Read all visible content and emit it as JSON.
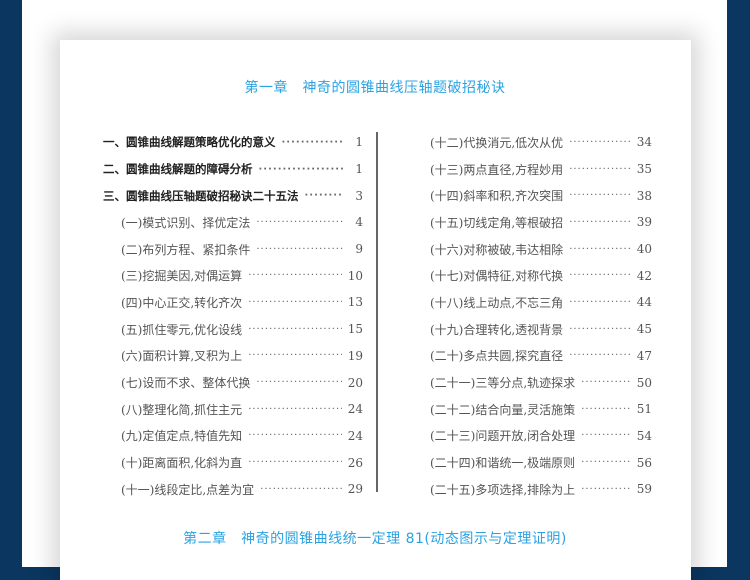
{
  "chapter1_title": "第一章　神奇的圆锥曲线压轴题破招秘诀",
  "chapter2_title": "第二章　神奇的圆锥曲线统一定理 81(动态图示与定理证明)",
  "left_items": [
    {
      "label": "一、圆锥曲线解题策略优化的意义",
      "page": "1"
    },
    {
      "label": "二、圆锥曲线解题的障碍分析",
      "page": "1"
    },
    {
      "label": "三、圆锥曲线压轴题破招秘诀二十五法",
      "page": "3"
    },
    {
      "label": "(一)模式识别、择优定法",
      "page": "4"
    },
    {
      "label": "(二)布列方程、紧扣条件",
      "page": "9"
    },
    {
      "label": "(三)挖掘美因,对偶运算",
      "page": "10"
    },
    {
      "label": "(四)中心正交,转化齐次",
      "page": "13"
    },
    {
      "label": "(五)抓住零元,优化设线",
      "page": "15"
    },
    {
      "label": "(六)面积计算,叉积为上",
      "page": "19"
    },
    {
      "label": "(七)设而不求、整体代换",
      "page": "20"
    },
    {
      "label": "(八)整理化简,抓住主元",
      "page": "24"
    },
    {
      "label": "(九)定值定点,特值先知",
      "page": "24"
    },
    {
      "label": "(十)距离面积,化斜为直",
      "page": "26"
    },
    {
      "label": "(十一)线段定比,点差为宜",
      "page": "29"
    }
  ],
  "right_items": [
    {
      "label": "(十二)代换消元,低次从优",
      "page": "34"
    },
    {
      "label": "(十三)两点直径,方程妙用",
      "page": "35"
    },
    {
      "label": "(十四)斜率和积,齐次突围",
      "page": "38"
    },
    {
      "label": "(十五)切线定角,等根破招",
      "page": "39"
    },
    {
      "label": "(十六)对称被破,韦达相除",
      "page": "40"
    },
    {
      "label": "(十七)对偶特征,对称代换",
      "page": "42"
    },
    {
      "label": "(十八)线上动点,不忘三角",
      "page": "44"
    },
    {
      "label": "(十九)合理转化,透视背景",
      "page": "45"
    },
    {
      "label": "(二十)多点共圆,探究直径",
      "page": "47"
    },
    {
      "label": "(二十一)三等分点,轨迹探求",
      "page": "50"
    },
    {
      "label": "(二十二)结合向量,灵活施策",
      "page": "51"
    },
    {
      "label": "(二十三)问题开放,闭合处理",
      "page": "54"
    },
    {
      "label": "(二十四)和谐统一,极端原则",
      "page": "56"
    },
    {
      "label": "(二十五)多项选择,排除为上",
      "page": "59"
    }
  ]
}
